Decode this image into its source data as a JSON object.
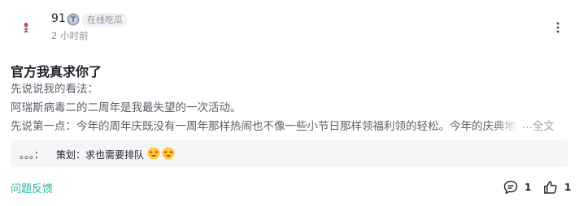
{
  "author": {
    "name": "91",
    "status_label": "在线吃瓜",
    "timestamp": "2 小时前"
  },
  "post": {
    "title": "官方我真求你了",
    "lines": [
      "先说说我的看法：",
      "阿瑞斯病毒二的二周年是我最失望的一次活动。",
      "先说第一点：今年的周年庆既没有一周年那样热闹也不像一些小节日那样领福利领的轻松。今年的庆典地"
    ],
    "ellipsis": "...",
    "more_text_label": "全文"
  },
  "comment": {
    "user": "。。。：",
    "text": "策划：求也需要排队",
    "emojis": [
      "starstruck-emoji",
      "starstruck-emoji"
    ]
  },
  "footer": {
    "feedback_label": "问题反馈",
    "comment_count": "1",
    "like_count": "1"
  },
  "colors": {
    "accent": "#2ab3a5",
    "muted_text": "#8a9099",
    "body_text": "#5b616b",
    "comment_bg": "#f4f5f7"
  }
}
